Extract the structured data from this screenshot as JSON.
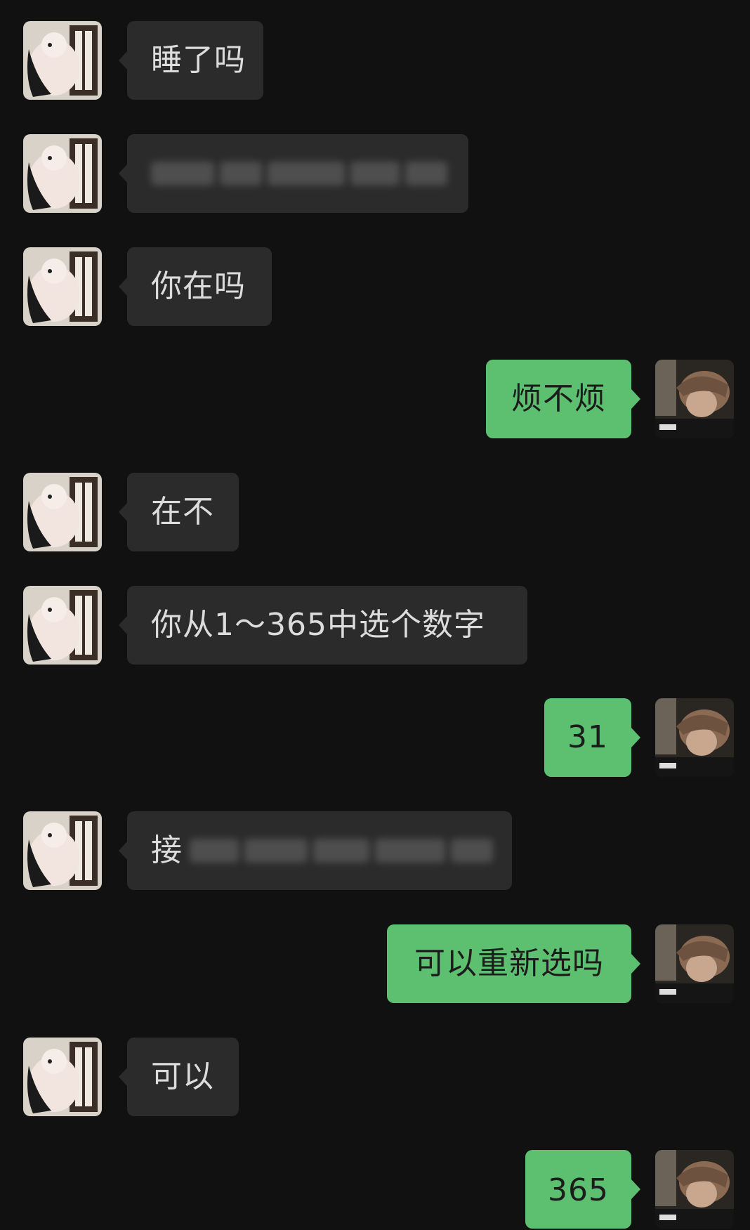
{
  "messages": [
    {
      "side": "in",
      "text": "睡了吗"
    },
    {
      "side": "in",
      "text": "",
      "blurred": true
    },
    {
      "side": "in",
      "text": "你在吗"
    },
    {
      "side": "out",
      "text": "烦不烦"
    },
    {
      "side": "in",
      "text": "在不"
    },
    {
      "side": "in",
      "text": "你从1～365中选个数字"
    },
    {
      "side": "out",
      "text": "31"
    },
    {
      "side": "in",
      "text": "接",
      "blurred": true
    },
    {
      "side": "out",
      "text": "可以重新选吗"
    },
    {
      "side": "in",
      "text": "可以"
    },
    {
      "side": "out",
      "text": "365"
    }
  ],
  "colors": {
    "background": "#111111",
    "incoming_bubble": "#2b2b2b",
    "outgoing_bubble": "#5cc070",
    "incoming_text": "#dcdcdc",
    "outgoing_text": "#1c1c1c"
  },
  "icons": {
    "incoming_avatar": "plush-toy-avatar",
    "outgoing_avatar": "person-avatar"
  }
}
